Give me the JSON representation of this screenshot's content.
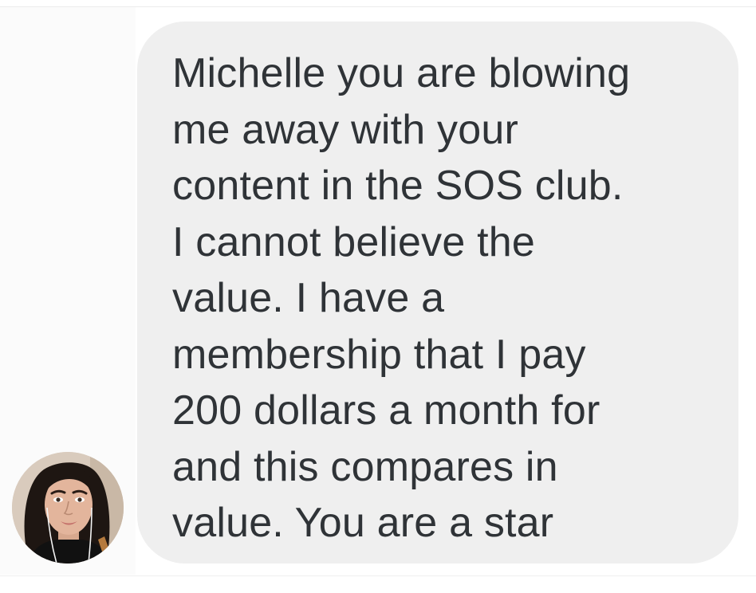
{
  "conversation": {
    "message": {
      "lines": [
        "Michelle you are blowing",
        "me away with your",
        "content in the SOS club.",
        "I cannot believe the",
        "value. I have a",
        "membership that I pay",
        "200 dollars a month for",
        "and this compares in",
        "value. You are a star"
      ]
    },
    "sender_avatar": {
      "icon": "profile-photo"
    }
  },
  "colors": {
    "bubble": "#efefef",
    "text": "#2f3337",
    "background": "#ffffff"
  }
}
